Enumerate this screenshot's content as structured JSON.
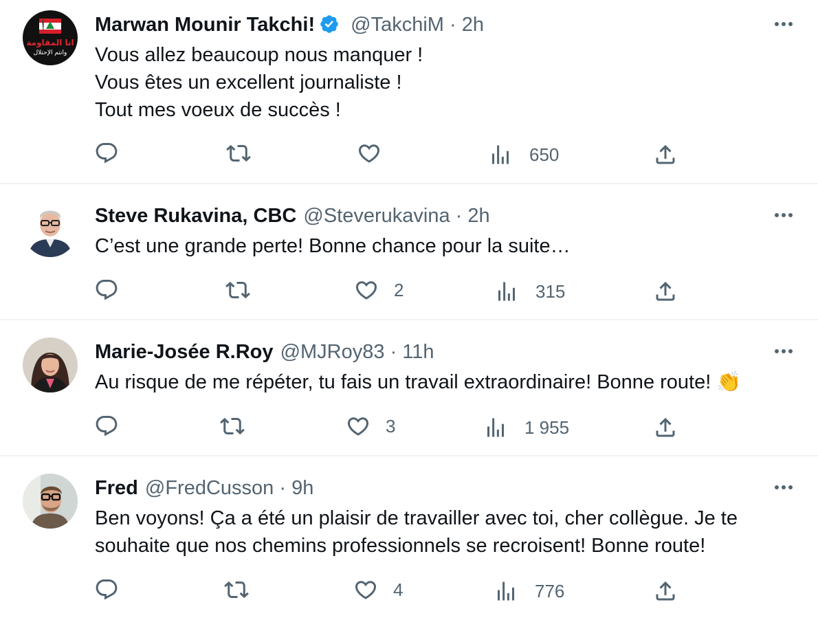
{
  "tweets": [
    {
      "name": "Marwan Mounir Takchi!",
      "verified": true,
      "handle": "@TakchiM",
      "separator": "·",
      "time": "2h",
      "avatar_text_top": "انا المقاومة",
      "avatar_text_bottom": "وانتم الإحتلال",
      "lines": [
        "Vous allez beaucoup nous manquer !",
        "Vous êtes un excellent journaliste !",
        "Tout mes voeux de succès !"
      ],
      "replies": "",
      "retweets": "",
      "likes": "",
      "views": "650"
    },
    {
      "name": "Steve Rukavina, CBC",
      "verified": false,
      "handle": "@Steverukavina",
      "separator": "·",
      "time": "2h",
      "lines": [
        "C’est une grande perte!  Bonne chance pour la suite…"
      ],
      "replies": "",
      "retweets": "",
      "likes": "2",
      "views": "315"
    },
    {
      "name": "Marie-Josée R.Roy",
      "verified": false,
      "handle": "@MJRoy83",
      "separator": "·",
      "time": "11h",
      "lines": [
        "Au risque de me répéter, tu fais un travail extraordinaire! Bonne route! 👏"
      ],
      "replies": "",
      "retweets": "",
      "likes": "3",
      "views": "1 955"
    },
    {
      "name": "Fred",
      "verified": false,
      "handle": "@FredCusson",
      "separator": "·",
      "time": "9h",
      "lines": [
        "Ben voyons! Ça a été un plaisir de travailler avec toi, cher collègue.  Je te",
        "souhaite que nos chemins professionnels se recroisent! Bonne route!"
      ],
      "replies": "",
      "retweets": "",
      "likes": "4",
      "views": "776"
    }
  ],
  "colors": {
    "text": "#0f1419",
    "muted": "#536471",
    "verified": "#1d9bf0",
    "divider": "#eff3f4"
  },
  "icons": [
    "reply-icon",
    "retweet-icon",
    "like-icon",
    "views-icon",
    "share-icon",
    "more-icon",
    "verified-badge-icon"
  ]
}
